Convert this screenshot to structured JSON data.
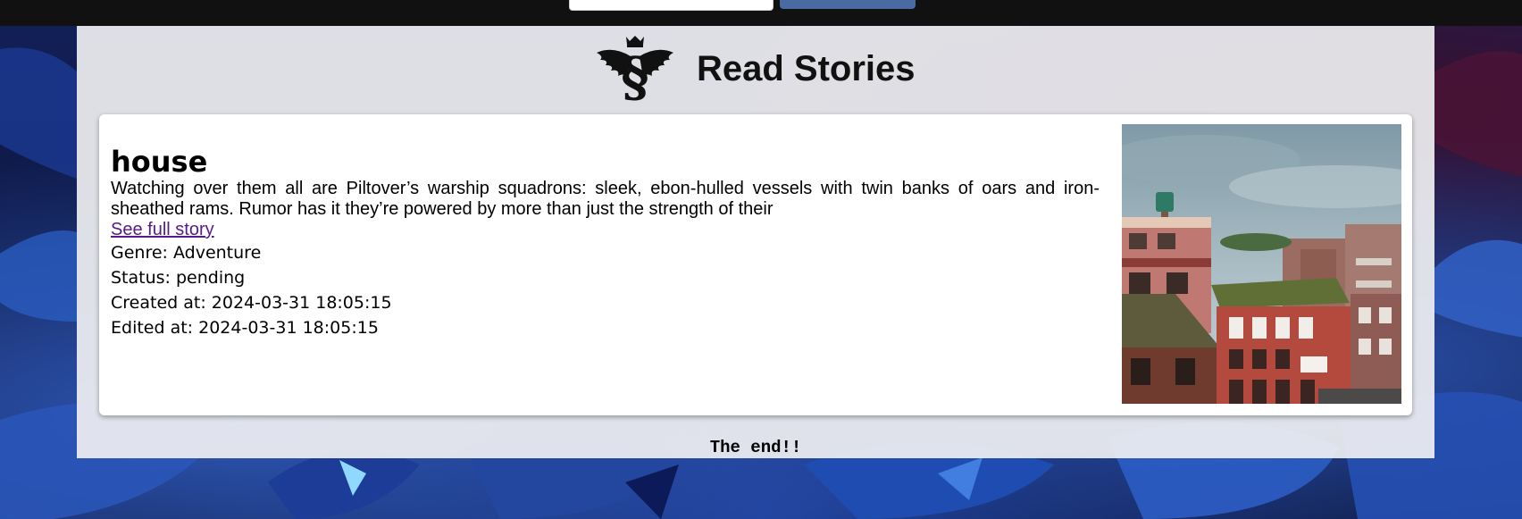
{
  "header": {
    "title": "Read Stories",
    "logo_icon": "winged-section-crest-logo"
  },
  "topbar": {
    "search_value": "",
    "button_label": ""
  },
  "story": {
    "title": "house",
    "excerpt": "Watching over them all are Piltover’s warship squadrons: sleek, ebon-hulled vessels with twin banks of oars and iron-sheathed rams. Rumor has it they’re powered by more than just the strength of their",
    "link_text": "See full story",
    "genre": "Genre: Adventure",
    "status": "Status: pending",
    "created": "Created at: 2024-03-31 18:05:15",
    "edited": "Edited at: 2024-03-31 18:05:15",
    "image_icon": "story-photo-buildings"
  },
  "footer": {
    "text": "The end!!"
  },
  "colors": {
    "topbar": "#111111",
    "button": "#4a6aa4",
    "link": "#551a8b",
    "card": "#ffffff"
  }
}
